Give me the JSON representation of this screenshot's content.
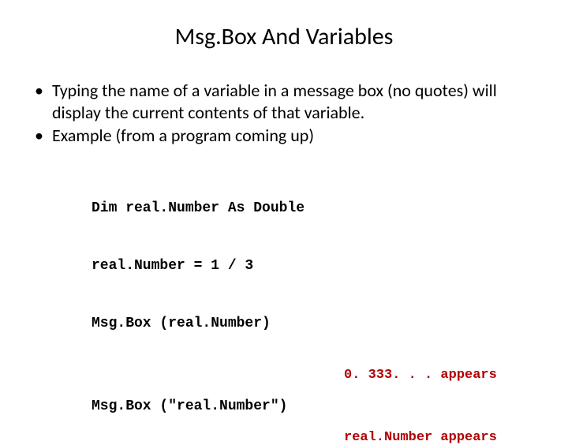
{
  "title": "Msg.Box And Variables",
  "bullets": [
    "Typing the name of a variable in a message box (no quotes) will display the current contents of that variable.",
    "Example (from a program coming up)"
  ],
  "code": {
    "line1": "Dim real.Number As Double",
    "line2": "real.Number = 1 / 3",
    "line3": "Msg.Box (real.Number)"
  },
  "output1": "0. 333. . . appears",
  "code2": "Msg.Box (\"real.Number\")",
  "output2": "real.Number appears"
}
